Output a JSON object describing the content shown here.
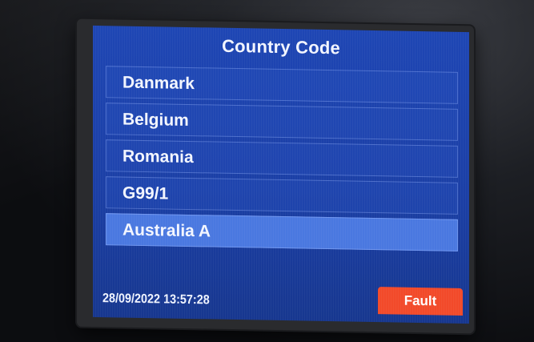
{
  "screen": {
    "title": "Country Code",
    "items": [
      {
        "label": "Danmark",
        "selected": false
      },
      {
        "label": "Belgium",
        "selected": false
      },
      {
        "label": "Romania",
        "selected": false
      },
      {
        "label": "G99/1",
        "selected": false
      },
      {
        "label": "Australia A",
        "selected": true
      }
    ],
    "datetime": "28/09/2022 13:57:28",
    "status_button": "Fault"
  },
  "colors": {
    "screen_bg": "#1e46b4",
    "selected_row": "#4a78e0",
    "fault_button": "#f24a2a",
    "text": "#ffffff"
  }
}
